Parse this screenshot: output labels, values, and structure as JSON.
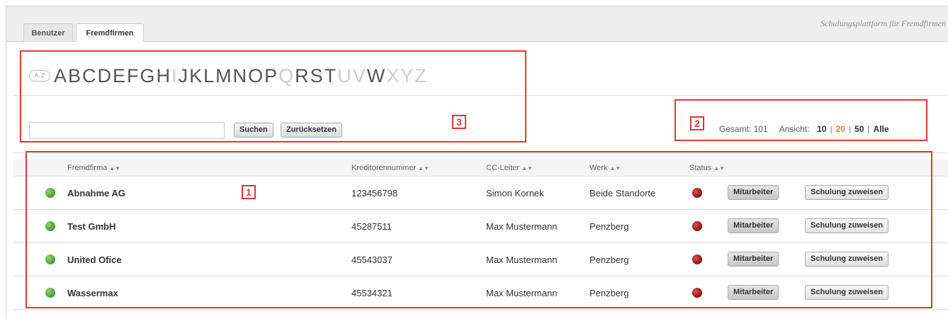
{
  "header": {
    "platform_title": "Schulungsplattform für Fremdfirmen",
    "tabs": [
      {
        "label": "Benutzer",
        "active": false
      },
      {
        "label": "Fremdfirmen",
        "active": true
      }
    ]
  },
  "alphabet": {
    "icon_label": "A..Z",
    "letters": [
      {
        "l": "A",
        "on": true
      },
      {
        "l": "B",
        "on": true
      },
      {
        "l": "C",
        "on": true
      },
      {
        "l": "D",
        "on": true
      },
      {
        "l": "E",
        "on": true
      },
      {
        "l": "F",
        "on": true
      },
      {
        "l": "G",
        "on": true
      },
      {
        "l": "H",
        "on": true
      },
      {
        "l": "I",
        "on": false
      },
      {
        "l": "J",
        "on": true
      },
      {
        "l": "K",
        "on": true
      },
      {
        "l": "L",
        "on": true
      },
      {
        "l": "M",
        "on": true
      },
      {
        "l": "N",
        "on": true
      },
      {
        "l": "O",
        "on": true
      },
      {
        "l": "P",
        "on": true
      },
      {
        "l": "Q",
        "on": false
      },
      {
        "l": "R",
        "on": true
      },
      {
        "l": "S",
        "on": true
      },
      {
        "l": "T",
        "on": true
      },
      {
        "l": "U",
        "on": false
      },
      {
        "l": "V",
        "on": false
      },
      {
        "l": "W",
        "on": true
      },
      {
        "l": "X",
        "on": false
      },
      {
        "l": "Y",
        "on": false
      },
      {
        "l": "Z",
        "on": false
      }
    ]
  },
  "search": {
    "value": "",
    "placeholder": "",
    "search_label": "Suchen",
    "reset_label": "Zurücksetzen"
  },
  "pager": {
    "total_label": "Gesamt: 101",
    "view_label": "Ansicht:",
    "options": [
      "10",
      "20",
      "50",
      "Alle"
    ],
    "current": "20"
  },
  "table": {
    "columns": [
      "Fremdfirma",
      "Kreditorennummer",
      "CC-Leiter",
      "Werk",
      "Status"
    ],
    "rows": [
      {
        "name": "Abnahme AG",
        "kreditor": "123456798",
        "leiter": "Simon Kornek",
        "werk": "Beide Standorte"
      },
      {
        "name": "Test GmbH",
        "kreditor": "45287511",
        "leiter": "Max Mustermann",
        "werk": "Penzberg"
      },
      {
        "name": "United Ofice",
        "kreditor": "45543037",
        "leiter": "Max Mustermann",
        "werk": "Penzberg"
      },
      {
        "name": "Wassermax",
        "kreditor": "45534321",
        "leiter": "Max Mustermann",
        "werk": "Penzberg"
      }
    ],
    "row_button_employees": "Mitarbeiter",
    "row_button_assign": "Schulung zuweisen",
    "active_color": "#4a9a2e",
    "status_color": "#8b1212"
  },
  "annotations": [
    "1",
    "2",
    "3"
  ]
}
